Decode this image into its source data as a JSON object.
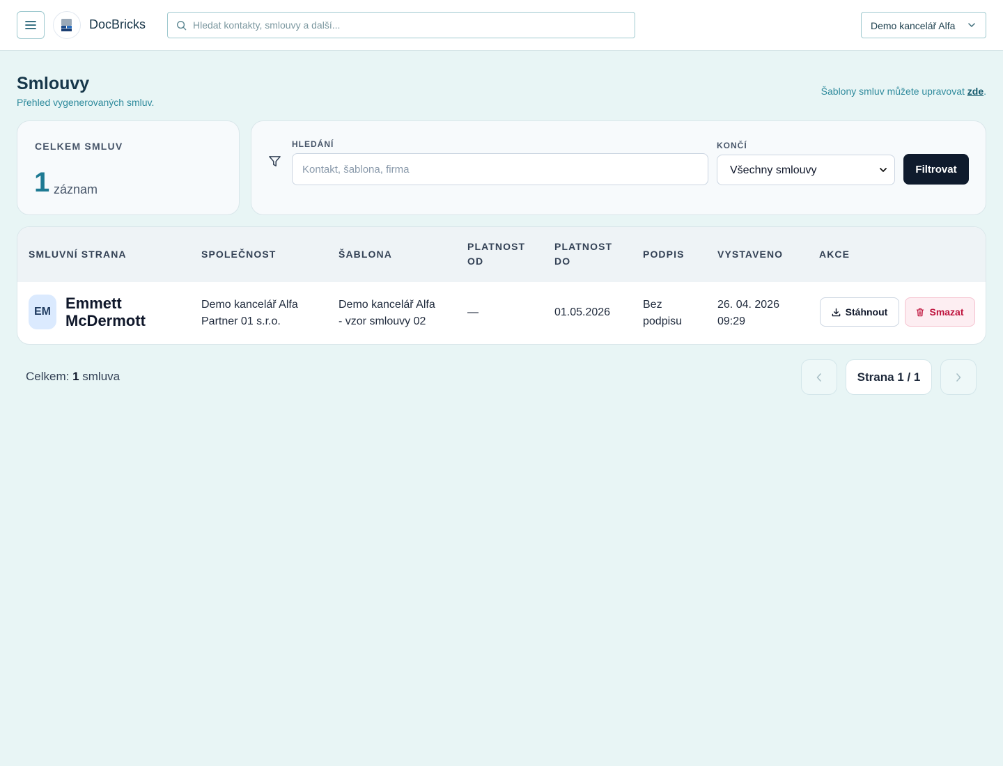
{
  "header": {
    "brand": "DocBricks",
    "search_placeholder": "Hledat kontakty, smlouvy a další...",
    "office": "Demo kancelář Alfa"
  },
  "page": {
    "title": "Smlouvy",
    "subtitle": "Přehled vygenerovaných smluv.",
    "template_note": "Šablony smluv můžete upravovat ",
    "template_link": "zde",
    "template_note_end": "."
  },
  "stats": {
    "label": "CELKEM SMLUV",
    "count": "1",
    "unit": "záznam"
  },
  "filter": {
    "search_label": "HLEDÁNÍ",
    "search_placeholder": "Kontakt, šablona, firma",
    "ends_label": "KONČÍ",
    "ends_value": "Všechny smlouvy",
    "button": "Filtrovat"
  },
  "table": {
    "columns": {
      "party": "SMLUVNÍ STRANA",
      "company": "SPOLEČNOST",
      "template": "ŠABLONA",
      "valid_from_1": "PLATNOST",
      "valid_from_2": "OD",
      "valid_to_1": "PLATNOST",
      "valid_to_2": "DO",
      "signature": "PODPIS",
      "issued": "VYSTAVENO",
      "actions": "AKCE"
    },
    "rows": [
      {
        "initials": "EM",
        "name_1": "Emmett",
        "name_2": "McDermott",
        "company_1": "Demo kancelář Alfa",
        "company_2": "Partner 01 s.r.o.",
        "template_1": "Demo kancelář Alfa",
        "template_2": "- vzor smlouvy 02",
        "valid_from": "—",
        "valid_to": "01.05.2026",
        "signature_1": "Bez",
        "signature_2": "podpisu",
        "issued_1": "26. 04. 2026",
        "issued_2": "09:29",
        "download": "Stáhnout",
        "delete": "Smazat"
      }
    ]
  },
  "footer": {
    "total_prefix": "Celkem: ",
    "total_count": "1",
    "total_suffix": " smluva",
    "page_label": "Strana 1 / 1"
  },
  "colors": {
    "background": "#e8f5f5",
    "accent": "#1e7a93",
    "primary_button": "#0f1b2d",
    "danger": "#be123c"
  }
}
